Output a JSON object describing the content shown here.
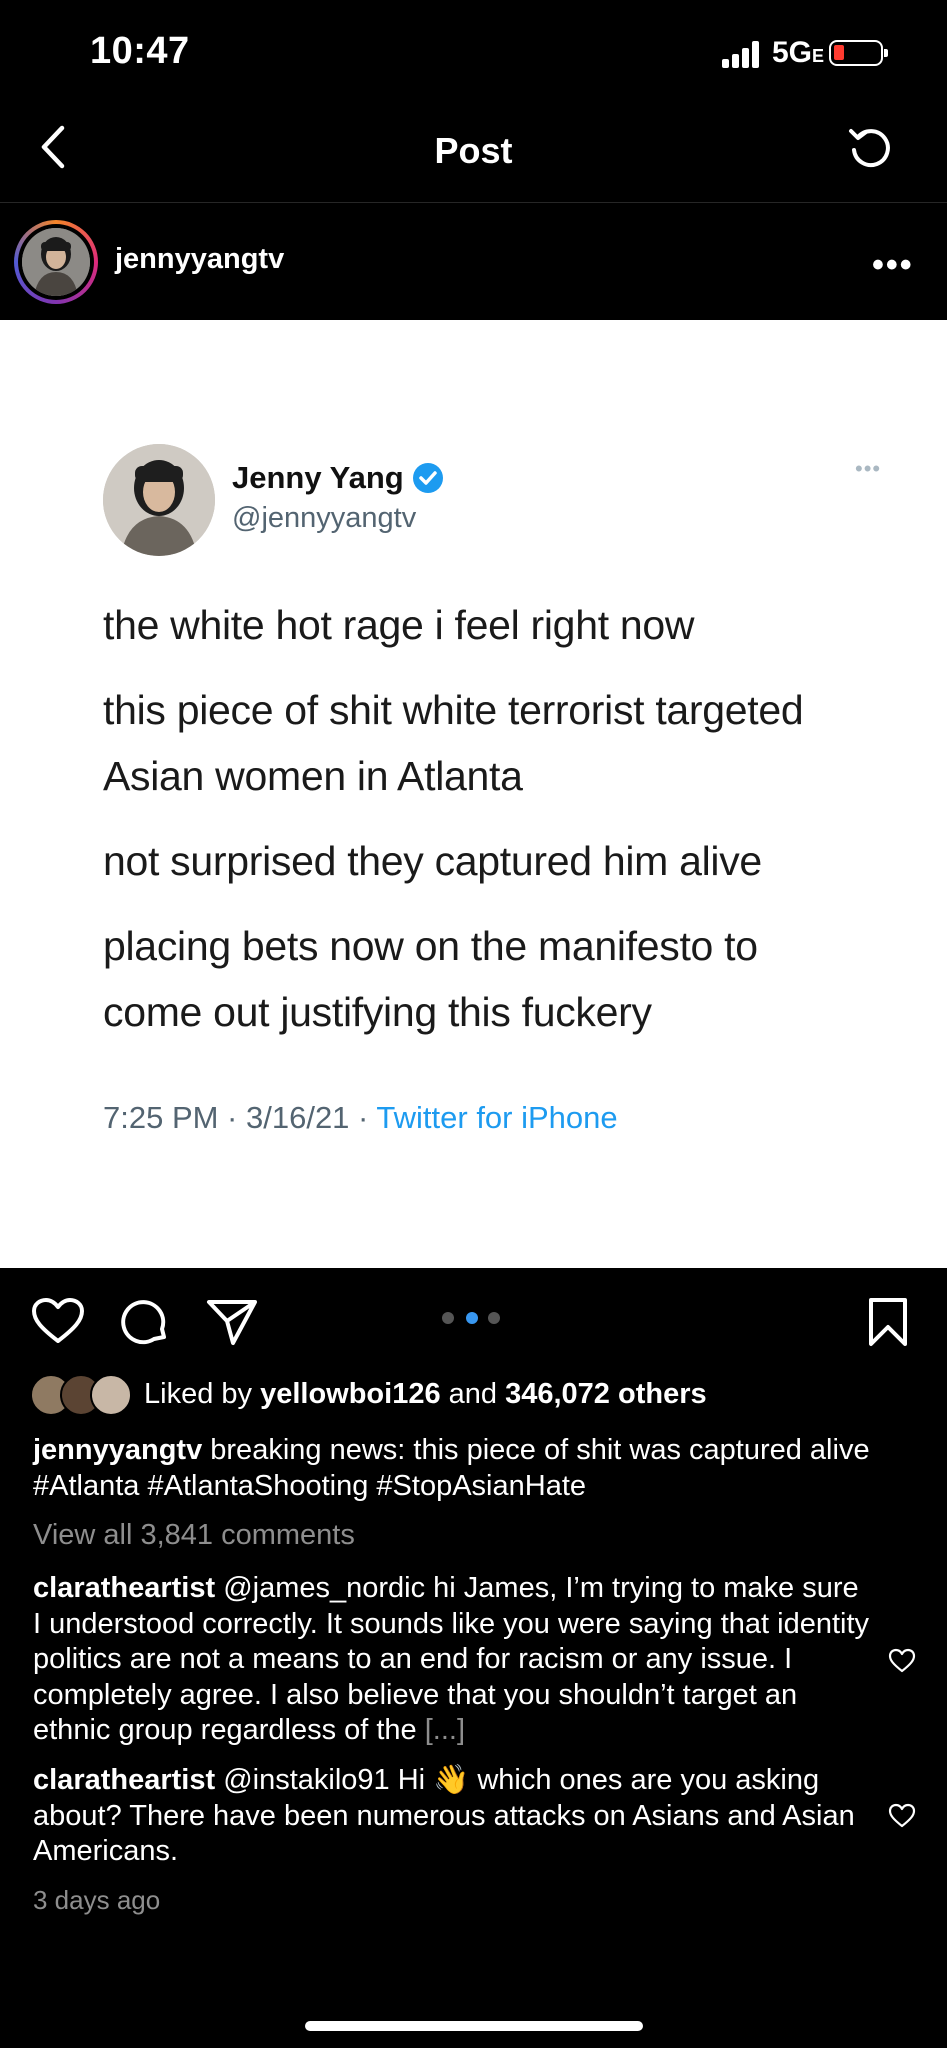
{
  "status_bar": {
    "time": "10:47",
    "network": "5G",
    "network_suffix": "E"
  },
  "header": {
    "title": "Post"
  },
  "post": {
    "username": "jennyyangtv",
    "tweet": {
      "name": "Jenny Yang",
      "handle": "@jennyyangtv",
      "lines": [
        "the white hot rage i feel right now",
        "this piece of shit white terrorist targeted",
        "Asian women in Atlanta",
        "not surprised they captured him alive",
        "placing bets now on the manifesto to",
        "come out justifying this fuckery"
      ],
      "time": "7:25 PM · 3/16/21 · ",
      "source": "Twitter for iPhone"
    },
    "carousel": {
      "count": 3,
      "active_index": 1
    },
    "likes": {
      "prefix": "Liked by ",
      "user": "yellowboi126",
      "middle": " and ",
      "others": "346,072 others"
    },
    "caption": {
      "username": "jennyyangtv",
      "text": " breaking news: this piece of shit was captured alive #Atlanta #AtlantaShooting #StopAsianHate"
    },
    "view_all_comments": "View all 3,841 comments",
    "comments": [
      {
        "username": "claratheartist",
        "text": " @james_nordic hi James, I’m trying to make sure I understood correctly. It sounds like you were saying that identity politics are not a means to an end for racism or any issue. I completely agree. I also believe that you shouldn’t target an ethnic group regardless of the ",
        "more": "[...]"
      },
      {
        "username": "claratheartist",
        "text": " @instakilo91 Hi 👋 which ones are you asking about? There have been numerous attacks on Asians and Asian Americans."
      }
    ],
    "timestamp": "3 days ago"
  },
  "colors": {
    "background": "#000000",
    "accent_blue": "#3897f0",
    "twitter_blue": "#1d9bf0",
    "muted": "#8e8e8e",
    "battery_low": "#ff3b30"
  }
}
